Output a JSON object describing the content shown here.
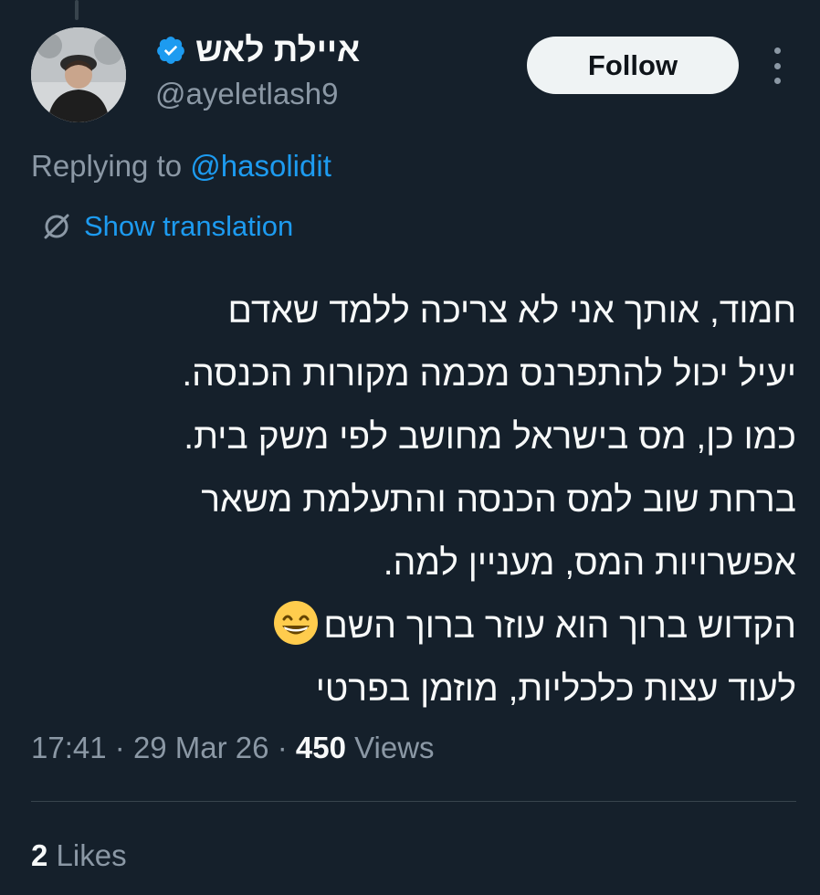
{
  "author": {
    "display_name": "איילת לאש",
    "handle": "@ayeletlash9",
    "verified": true
  },
  "follow_button": {
    "label": "Follow"
  },
  "reply_context": {
    "prefix": "Replying to",
    "mention": "@hasolidit"
  },
  "translation": {
    "label": "Show translation"
  },
  "tweet": {
    "lines": [
      "חמוד, אותך אני לא צריכה ללמד שאדם",
      "יעיל יכול להתפרנס מכמה מקורות הכנסה.",
      "כמו כן, מס בישראל מחושב לפי משק בית.",
      "ברחת שוב למס הכנסה והתעלמת משאר",
      "אפשרויות המס, מעניין למה.",
      "הקדוש ברוך הוא עוזר ברוך השם",
      "לעוד עצות כלכליות, מוזמן בפרטי"
    ],
    "emoji": "grinning-face-with-smiling-eyes"
  },
  "meta": {
    "time": "17:41",
    "separator": "·",
    "date": "29 Mar 26",
    "views_count": "450",
    "views_label": "Views"
  },
  "stats": {
    "likes_count": "2",
    "likes_label": "Likes"
  },
  "colors": {
    "background": "#15202b",
    "accent": "#1d9bf0",
    "secondary_text": "#8b98a5",
    "primary_text": "#f7f9f9"
  }
}
